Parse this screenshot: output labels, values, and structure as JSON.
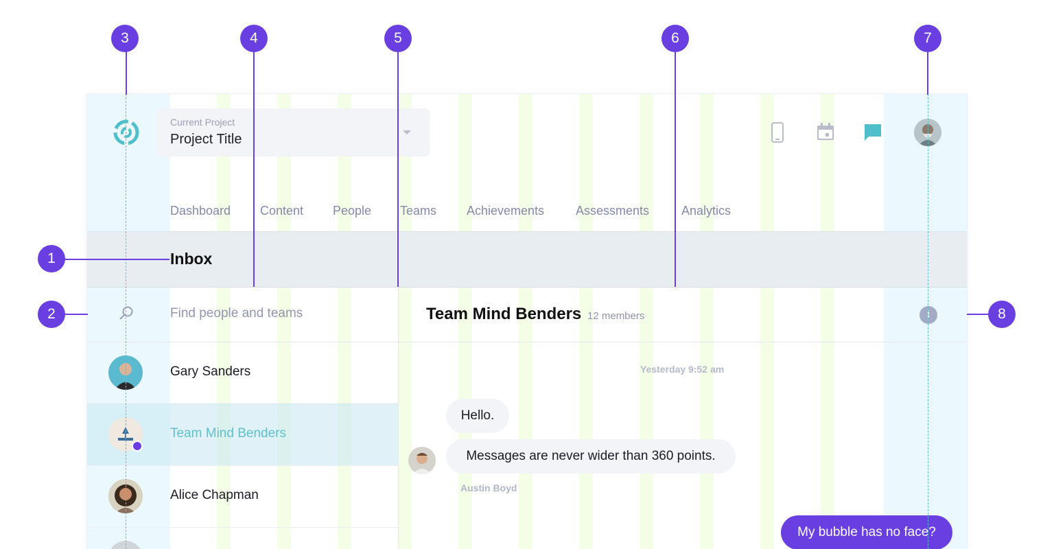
{
  "colors": {
    "accent": "#6a3fe1",
    "brand_teal": "#4fbfcc",
    "muted_text": "#8489a8"
  },
  "project": {
    "label": "Current Project",
    "title": "Project Title"
  },
  "top_icons": [
    "phone-icon",
    "calendar-icon",
    "chat-icon",
    "avatar"
  ],
  "nav": [
    "Dashboard",
    "Content",
    "People",
    "Teams",
    "Achievements",
    "Assessments",
    "Analytics"
  ],
  "inbox": {
    "title": "Inbox"
  },
  "search": {
    "placeholder": "Find people and teams"
  },
  "conversations": [
    {
      "name": "Gary Sanders",
      "selected": false
    },
    {
      "name": "Team Mind Benders",
      "selected": true,
      "unread": true
    },
    {
      "name": "Alice Chapman",
      "selected": false
    }
  ],
  "chat": {
    "team_name": "Team Mind Benders",
    "members": "12 members",
    "timestamp": "Yesterday 9:52 am",
    "messages": [
      {
        "text": "Hello.",
        "from": "other"
      },
      {
        "text": "Messages are never wider than 360 points.",
        "from": "other"
      },
      {
        "text": "My bubble has no face?",
        "from": "me"
      }
    ],
    "sender_name": "Austin Boyd"
  },
  "annotations": [
    "1",
    "2",
    "3",
    "4",
    "5",
    "6",
    "7",
    "8"
  ]
}
